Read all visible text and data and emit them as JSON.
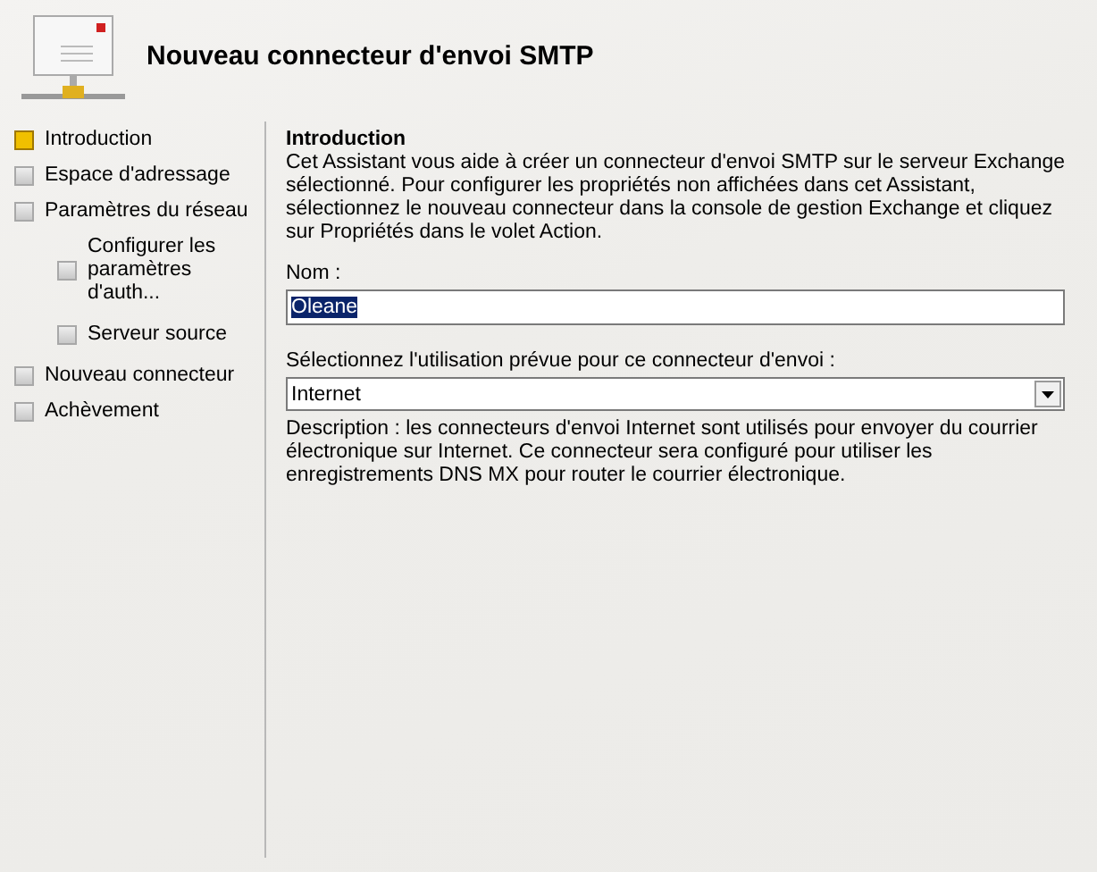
{
  "header": {
    "title": "Nouveau connecteur d'envoi SMTP"
  },
  "steps": [
    {
      "label": "Introduction",
      "selected": true
    },
    {
      "label": "Espace d'adressage",
      "selected": false
    },
    {
      "label": "Paramètres du réseau",
      "selected": false,
      "children": [
        {
          "label": "Configurer les paramètres d'auth...",
          "selected": false
        },
        {
          "label": "Serveur source",
          "selected": false
        }
      ]
    },
    {
      "label": "Nouveau connecteur",
      "selected": false
    },
    {
      "label": "Achèvement",
      "selected": false
    }
  ],
  "page": {
    "heading": "Introduction",
    "intro": "Cet Assistant vous aide à créer un connecteur d'envoi SMTP sur le serveur Exchange sélectionné. Pour configurer les propriétés non affichées dans cet Assistant, sélectionnez le nouveau connecteur dans la console de gestion Exchange et cliquez sur Propriétés dans le volet Action.",
    "name_label": "Nom :",
    "name_field": {
      "value": "Oleane",
      "text_selected": true
    },
    "usage_label": "Sélectionnez l'utilisation prévue pour ce connecteur d'envoi :",
    "usage_dropdown": {
      "value": "Internet"
    },
    "description": "Description : les connecteurs d'envoi Internet sont utilisés pour envoyer du courrier électronique sur Internet. Ce connecteur sera configuré pour utiliser les enregistrements DNS MX pour router le courrier électronique."
  }
}
